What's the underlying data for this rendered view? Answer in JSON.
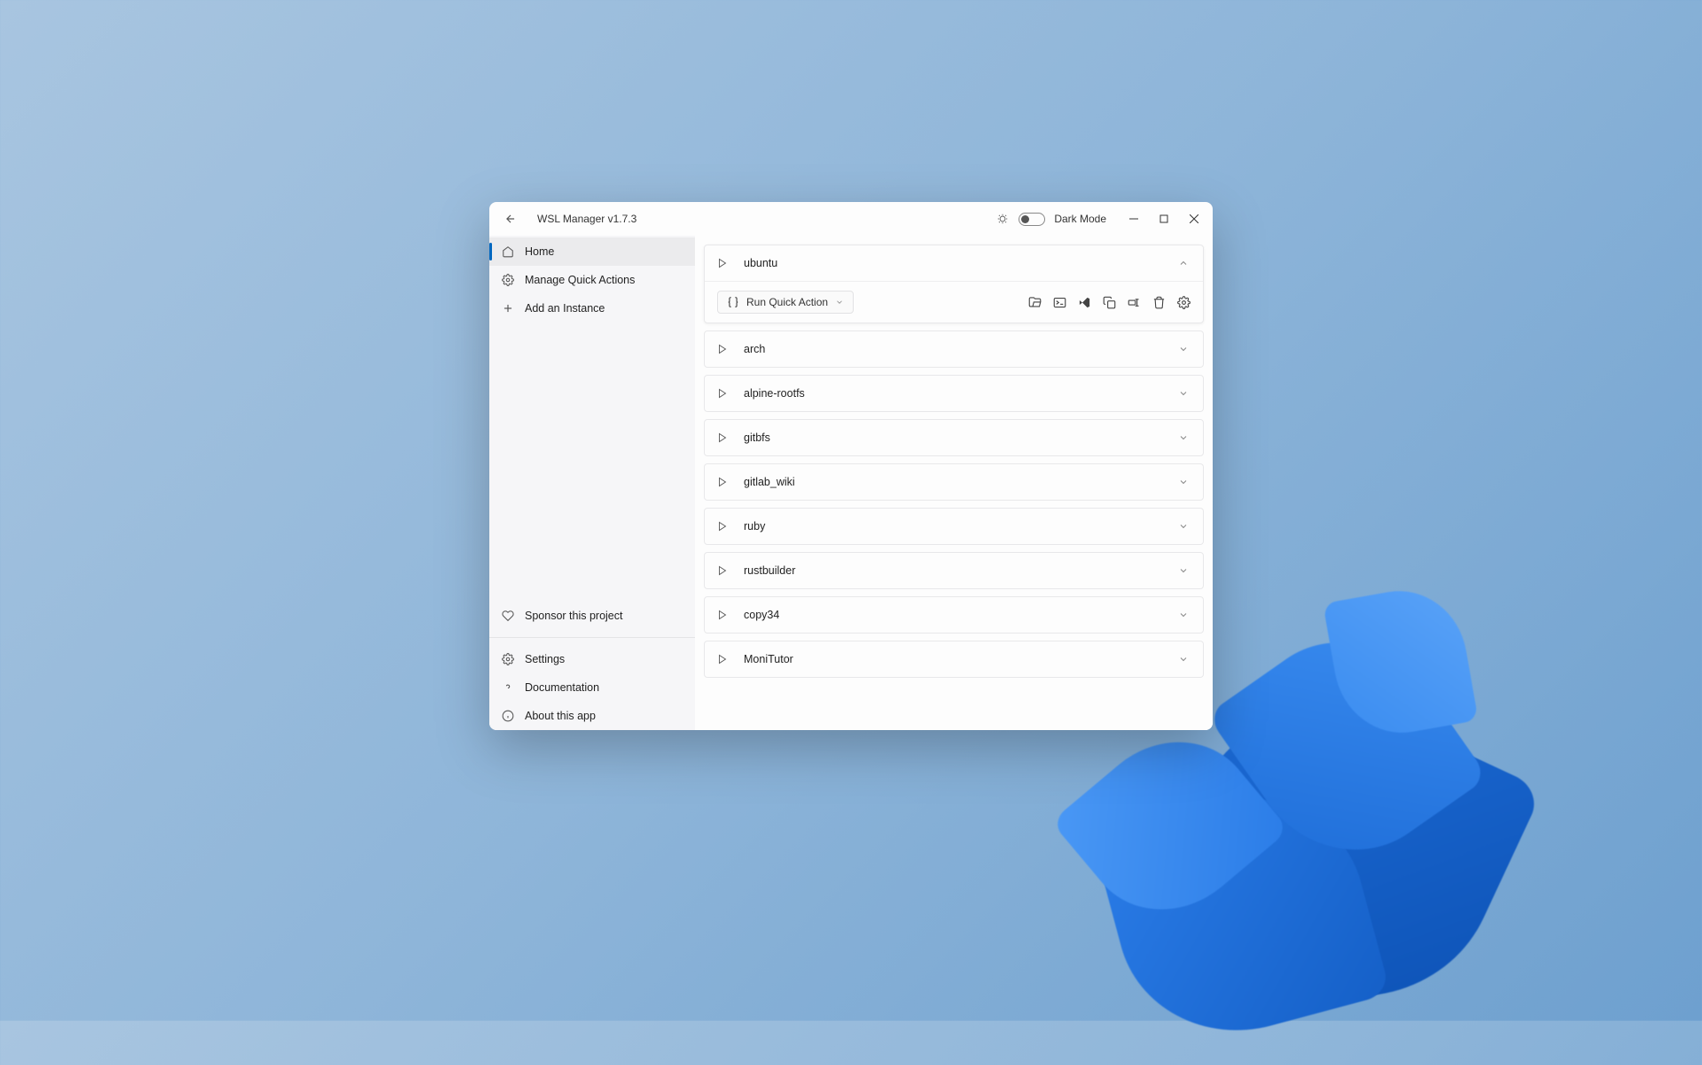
{
  "titlebar": {
    "title": "WSL Manager v1.7.3",
    "mode_label": "Dark Mode"
  },
  "sidebar": {
    "top_items": [
      {
        "label": "Home",
        "icon": "home"
      },
      {
        "label": "Manage Quick Actions",
        "icon": "gear"
      },
      {
        "label": "Add an Instance",
        "icon": "plus"
      }
    ],
    "sponsor_label": "Sponsor this project",
    "bottom_items": [
      {
        "label": "Settings",
        "icon": "gear"
      },
      {
        "label": "Documentation",
        "icon": "question"
      },
      {
        "label": "About this app",
        "icon": "info"
      }
    ]
  },
  "content": {
    "quick_action_label": "Run Quick Action",
    "instances": [
      {
        "name": "ubuntu",
        "expanded": true
      },
      {
        "name": "arch",
        "expanded": false
      },
      {
        "name": "alpine-rootfs",
        "expanded": false
      },
      {
        "name": "gitbfs",
        "expanded": false
      },
      {
        "name": "gitlab_wiki",
        "expanded": false
      },
      {
        "name": "ruby",
        "expanded": false
      },
      {
        "name": "rustbuilder",
        "expanded": false
      },
      {
        "name": "copy34",
        "expanded": false
      },
      {
        "name": "MoniTutor",
        "expanded": false
      }
    ]
  }
}
